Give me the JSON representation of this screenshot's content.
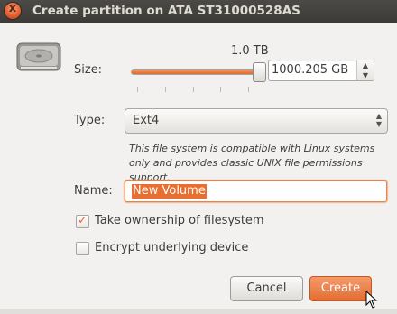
{
  "window": {
    "title": "Create partition on ATA ST31000528AS",
    "close_glyph": "x"
  },
  "size": {
    "label": "Size:",
    "value_display": "1.0 TB",
    "spin_value": "1000.205 GB",
    "slider_fraction": 1.0
  },
  "type": {
    "label": "Type:",
    "selected": "Ext4",
    "help_text": "This file system is compatible with Linux systems only and provides classic UNIX file permissions support."
  },
  "name": {
    "label": "Name:",
    "value": "New Volume"
  },
  "options": {
    "take_ownership": {
      "label": "Take ownership of filesystem",
      "checked": true
    },
    "encrypt": {
      "label": "Encrypt underlying device",
      "checked": false
    }
  },
  "buttons": {
    "cancel": "Cancel",
    "create": "Create"
  },
  "colors": {
    "accent": "#e36d33",
    "titlebar": "#3c3b37",
    "background": "#f2f1f0"
  },
  "icons": {
    "window_close": "close-icon",
    "disk": "hard-disk-icon",
    "checkmark": "checkmark-icon",
    "cursor": "mouse-pointer-icon"
  }
}
